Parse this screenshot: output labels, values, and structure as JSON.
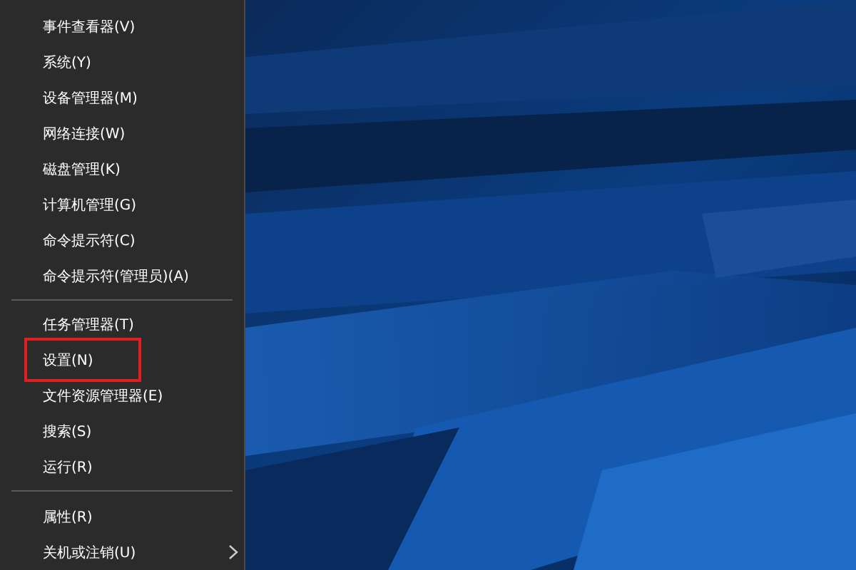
{
  "menu": {
    "sections": [
      {
        "items": [
          {
            "label": "事件查看器(V)",
            "highlighted": false,
            "submenu": false
          },
          {
            "label": "系统(Y)",
            "highlighted": false,
            "submenu": false
          },
          {
            "label": "设备管理器(M)",
            "highlighted": false,
            "submenu": false
          },
          {
            "label": "网络连接(W)",
            "highlighted": false,
            "submenu": false
          },
          {
            "label": "磁盘管理(K)",
            "highlighted": false,
            "submenu": false
          },
          {
            "label": "计算机管理(G)",
            "highlighted": false,
            "submenu": false
          },
          {
            "label": "命令提示符(C)",
            "highlighted": false,
            "submenu": false
          },
          {
            "label": "命令提示符(管理员)(A)",
            "highlighted": false,
            "submenu": false
          }
        ]
      },
      {
        "items": [
          {
            "label": "任务管理器(T)",
            "highlighted": false,
            "submenu": false
          },
          {
            "label": "设置(N)",
            "highlighted": true,
            "submenu": false
          },
          {
            "label": "文件资源管理器(E)",
            "highlighted": false,
            "submenu": false
          },
          {
            "label": "搜索(S)",
            "highlighted": false,
            "submenu": false
          },
          {
            "label": "运行(R)",
            "highlighted": false,
            "submenu": false
          }
        ]
      },
      {
        "items": [
          {
            "label": "属性(R)",
            "highlighted": false,
            "submenu": false
          },
          {
            "label": "关机或注销(U)",
            "highlighted": false,
            "submenu": true
          }
        ]
      }
    ]
  }
}
